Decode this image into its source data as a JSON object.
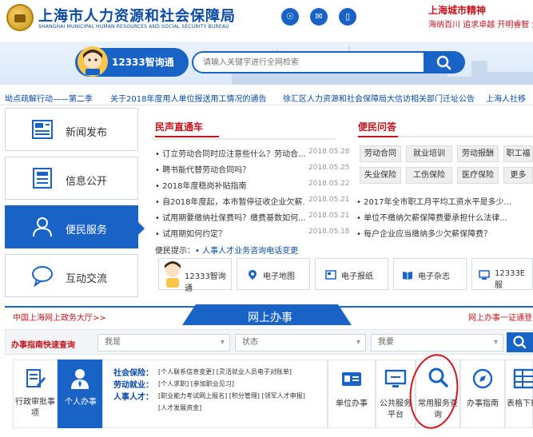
{
  "header": {
    "title": "上海市人力资源和社会保障局",
    "subtitle": "SHANGHAI MUNICIPAL HUMAN RESOURCES AND SOCIAL SECURITY BUREAU",
    "social": [
      {
        "icon": "weibo-icon",
        "glyph": "☉"
      },
      {
        "icon": "wechat-icon",
        "glyph": "✉"
      },
      {
        "icon": "mobile-icon",
        "glyph": "▯"
      }
    ],
    "city_spirit_title": "上海城市精神",
    "city_spirit_motto": "海纳百川  追求卓越  开明睿智  大气"
  },
  "search": {
    "assistant_label": "12333智询通",
    "placeholder": "请输入关键字进行全网检索"
  },
  "ticker": [
    "坳点疏解行动——第二季",
    "关于2018年度用人单位报送用工情况的通告",
    "徐汇区人力资源和社会保障局大信访相关部门迁址公告",
    "上海人社移"
  ],
  "nav": [
    {
      "label": "新闻发布",
      "icon": "newspaper-icon"
    },
    {
      "label": "信息公开",
      "icon": "document-icon"
    },
    {
      "label": "便民服务",
      "icon": "users-icon"
    },
    {
      "label": "互动交流",
      "icon": "chat-icon"
    }
  ],
  "news": {
    "tab": "民声直通车",
    "items": [
      {
        "title": "订立劳动合同时应注意些什么？劳动合...",
        "date": "2018.05.28"
      },
      {
        "title": "聘书能代替劳动合同吗？",
        "date": "2018.05.25"
      },
      {
        "title": "2018年度稳岗补贴指南",
        "date": "2018.05.22"
      },
      {
        "title": "自2018年度起，本市暂停征收企业欠薪...",
        "date": "2018.05.21"
      },
      {
        "title": "试用期要缴纳社保费吗？缴费基数如何...",
        "date": "2018.05.21"
      },
      {
        "title": "试用期如何约定？",
        "date": "2018.05.18"
      }
    ]
  },
  "service": {
    "tab": "便民问答",
    "tags_row1": [
      "劳动合同",
      "就业培训",
      "劳动报酬",
      "职工福"
    ],
    "tags_row2": [
      "失业保险",
      "工伤保险",
      "医疗保险",
      "更多"
    ],
    "items": [
      "2017年全市职工月平均工资水平是多少...",
      "单位不缴纳欠薪保障费要承担什么法律...",
      "每户企业应当缴纳多少欠薪保障费？"
    ]
  },
  "tip": {
    "prefix": "便民提示：",
    "link": "• 人事人才业务咨询电话变更"
  },
  "quick": [
    {
      "label": "12333智询通",
      "icon": "assistant-icon"
    },
    {
      "label": "电子地图",
      "icon": "map-pin-icon"
    },
    {
      "label": "电子报纸",
      "icon": "newspaper-small-icon"
    },
    {
      "label": "电子杂志",
      "icon": "book-icon"
    },
    {
      "label": "12333E服",
      "icon": "computer-icon"
    }
  ],
  "portal": {
    "left": "中国上海网上政务大厅>>",
    "center": "网上办事",
    "right": "网上办事一证通登"
  },
  "filter": {
    "label": "办事指南快速查询",
    "selects": [
      "我是",
      "状态",
      "我要"
    ]
  },
  "services": {
    "admin": "行政审批事项",
    "personal": "个人办事",
    "categories": [
      {
        "label": "社会保险：",
        "links": "[个人联系信息变更]  [灵活就业人员电子对账单]"
      },
      {
        "label": "劳动就业：",
        "links": "[个人求职]  [参加职业见习]"
      },
      {
        "label": "人事人才：",
        "links": "[职业能力考试网上报名]  [积分管理]  [领军人才申报]"
      },
      {
        "label": "",
        "links": "[人才发展资金]"
      }
    ],
    "unit": "单位办事",
    "public_platform": "公共服务平台",
    "query": "常用服务查询",
    "guide": "办事指南",
    "form": "表格下载"
  }
}
